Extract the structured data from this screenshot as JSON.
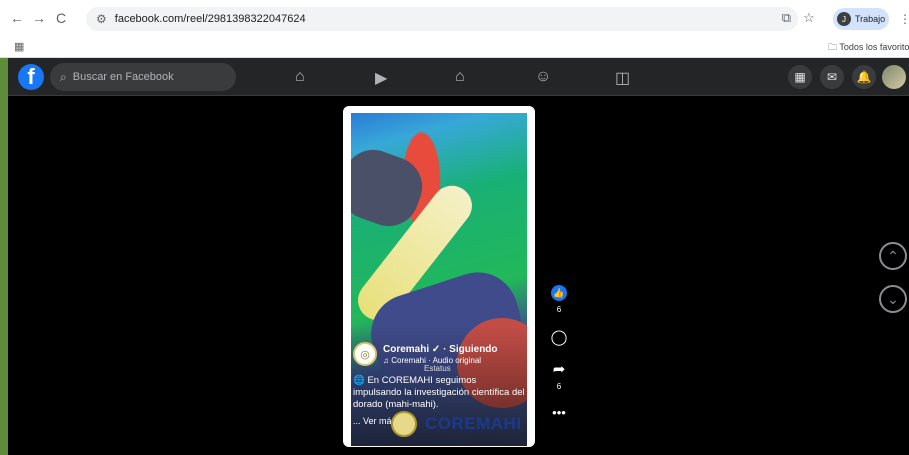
{
  "browser": {
    "back": "←",
    "forward": "→",
    "reload": "C",
    "url": "facebook.com/reel/2981398322047624",
    "profile_label": "Trabajo",
    "profile_initial": "J",
    "bookmark_folder": "Todos los favoritos"
  },
  "facebook": {
    "search_placeholder": "Buscar en Facebook"
  },
  "reel": {
    "author": "Coremahi",
    "following": "· Siguiendo",
    "audio": "♫ Coremahi · Audio original",
    "overlay_text": "Estatus",
    "caption": "En COREMAHI seguimos impulsando la investigación científica del dorado (mahi-mahi).",
    "see_more": "... Ver más",
    "watermark": "COREMAHI",
    "likes": "6",
    "shares": "6"
  },
  "colors": {
    "fb_blue": "#1877f2",
    "fb_topbar": "#242526",
    "watermark_text": "#1a3a8c"
  }
}
